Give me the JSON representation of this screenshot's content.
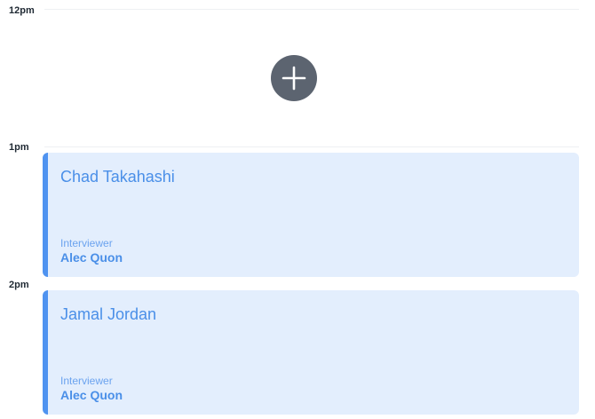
{
  "time_labels": [
    "12pm",
    "1pm",
    "2pm"
  ],
  "add_button": {
    "icon": "plus-icon",
    "color": "#5c6470"
  },
  "events": [
    {
      "title": "Chad Takahashi",
      "role_label": "Interviewer",
      "person": "Alec Quon"
    },
    {
      "title": "Jamal Jordan",
      "role_label": "Interviewer",
      "person": "Alec Quon"
    }
  ],
  "colors": {
    "event_background": "#e3eefd",
    "event_accent": "#4f93f0",
    "event_text": "#4a8fe8"
  }
}
